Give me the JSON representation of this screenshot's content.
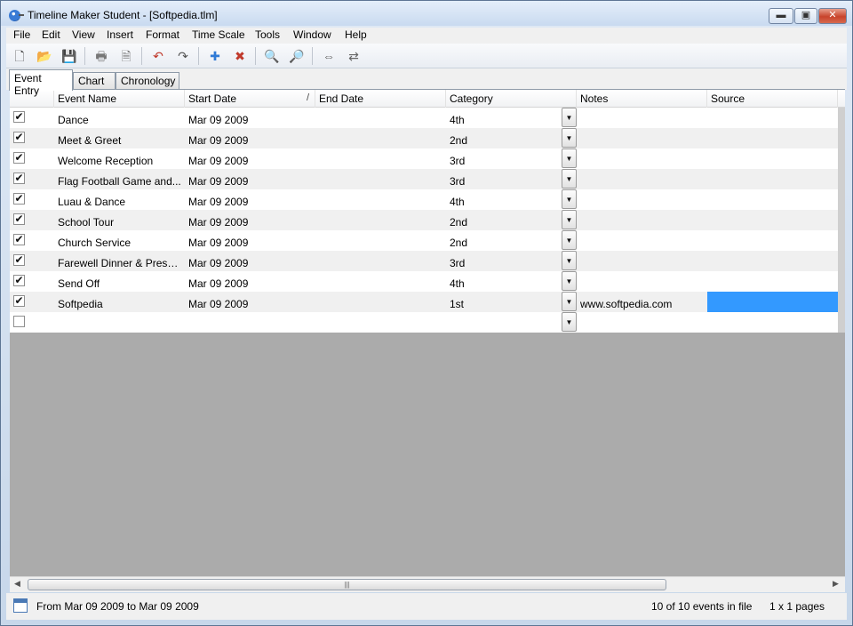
{
  "window": {
    "title": "Timeline Maker Student - [Softpedia.tlm]",
    "minimize_label": "▬",
    "maximize_label": "▣",
    "close_label": "✕"
  },
  "menu": [
    "File",
    "Edit",
    "View",
    "Insert",
    "Format",
    "Time Scale",
    "Tools",
    "Window",
    "Help"
  ],
  "toolbar": {
    "icons": [
      "new-file-icon",
      "open-folder-icon",
      "save-icon",
      "print-icon",
      "print-preview-icon",
      "undo-icon",
      "redo-icon",
      "add-event-icon",
      "delete-event-icon",
      "zoom-in-icon",
      "zoom-out-icon",
      "expand-icon",
      "collapse-icon"
    ],
    "glyphs": [
      "🗋",
      "📂",
      "💾",
      "🖶",
      "🗎",
      "↶",
      "↷",
      "✚",
      "✖",
      "🔍",
      "🔎",
      "⇔",
      "⇄"
    ]
  },
  "tabs": [
    "Event Entry",
    "Chart",
    "Chronology"
  ],
  "columns": {
    "event_name": "Event Name",
    "start_date": "Start Date",
    "sort_indicator": "/",
    "end_date": "End Date",
    "category": "Category",
    "notes": "Notes",
    "source": "Source"
  },
  "rows": [
    {
      "checked": "✔",
      "name": "Dance",
      "start": "Mar 09 2009",
      "category": "4th",
      "notes": ""
    },
    {
      "checked": "✔",
      "name": "Meet & Greet",
      "start": "Mar 09 2009",
      "category": "2nd",
      "notes": ""
    },
    {
      "checked": "✔",
      "name": "Welcome Reception",
      "start": "Mar 09 2009",
      "category": "3rd",
      "notes": ""
    },
    {
      "checked": "✔",
      "name": "Flag Football Game and...",
      "start": "Mar 09 2009",
      "category": "3rd",
      "notes": ""
    },
    {
      "checked": "✔",
      "name": "Luau & Dance",
      "start": "Mar 09 2009",
      "category": "4th",
      "notes": ""
    },
    {
      "checked": "✔",
      "name": "School Tour",
      "start": "Mar 09 2009",
      "category": "2nd",
      "notes": ""
    },
    {
      "checked": "✔",
      "name": "Church Service",
      "start": "Mar 09 2009",
      "category": "2nd",
      "notes": ""
    },
    {
      "checked": "✔",
      "name": "Farewell Dinner & Prese...",
      "start": "Mar 09 2009",
      "category": "3rd",
      "notes": ""
    },
    {
      "checked": "✔",
      "name": "Send Off",
      "start": "Mar 09 2009",
      "category": "4th",
      "notes": ""
    },
    {
      "checked": "✔",
      "name": "Softpedia",
      "start": "Mar 09 2009",
      "category": "1st",
      "notes": "www.softpedia.com"
    },
    {
      "checked": "",
      "name": "",
      "start": "",
      "category": "",
      "notes": ""
    }
  ],
  "dropdown_glyph": "▼",
  "scroll": {
    "left": "◀",
    "right": "▶",
    "grip": "|||"
  },
  "status": {
    "date_range": "From Mar 09 2009 to Mar 09 2009",
    "event_count": "10 of 10 events in file",
    "pages": "1 x 1 pages"
  }
}
